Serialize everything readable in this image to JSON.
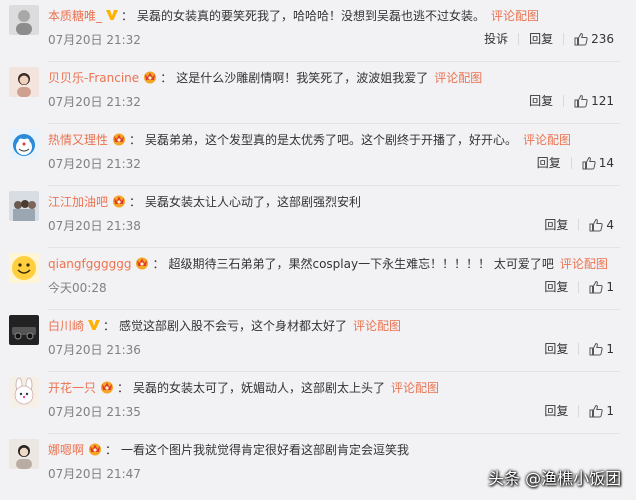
{
  "comments": [
    {
      "user": "本质糖唯_",
      "badge": "v",
      "text": "吴磊的女装真的要笑死我了，哈哈哈！没想到吴磊也逃不过女装。",
      "media_link": "评论配图",
      "time": "07月20日 21:32",
      "report": "投诉",
      "reply": "回复",
      "likes": "236"
    },
    {
      "user": "贝贝乐-Francine",
      "badge": "crown",
      "text": "这是什么沙雕剧情啊！我笑死了，波波姐我爱了",
      "media_link": "评论配图",
      "time": "07月20日 21:32",
      "report": "",
      "reply": "回复",
      "likes": "121"
    },
    {
      "user": "热情又理性",
      "badge": "crown",
      "text": "吴磊弟弟，这个发型真的是太优秀了吧。这个剧终于开播了，好开心。",
      "media_link": "评论配图",
      "time": "07月20日 21:32",
      "report": "",
      "reply": "回复",
      "likes": "14"
    },
    {
      "user": "江江加油吧",
      "badge": "crown",
      "text": "吴磊女装太让人心动了，这部剧强烈安利",
      "media_link": "",
      "time": "07月20日 21:38",
      "report": "",
      "reply": "回复",
      "likes": "4"
    },
    {
      "user": "qiangfgggggg",
      "badge": "crown",
      "text": "超级期待三石弟弟了，果然cosplay一下永生难忘！！！！！ 太可爱了吧",
      "media_link": "评论配图",
      "time": "今天00:28",
      "report": "",
      "reply": "回复",
      "likes": "1"
    },
    {
      "user": "白川崎",
      "badge": "v",
      "text": "感觉这部剧入股不会亏，这个身材都太好了",
      "media_link": "评论配图",
      "time": "07月20日 21:36",
      "report": "",
      "reply": "回复",
      "likes": "1"
    },
    {
      "user": "开花一只",
      "badge": "crown",
      "text": "吴磊的女装太可了，妩媚动人，这部剧太上头了",
      "media_link": "评论配图",
      "time": "07月20日 21:35",
      "report": "",
      "reply": "回复",
      "likes": "1"
    },
    {
      "user": "娜嗯啊",
      "badge": "crown",
      "text": "一看这个图片我就觉得肯定很好看这部剧肯定会逗笑我",
      "media_link": "",
      "time": "07月20日 21:47",
      "report": "",
      "reply": "",
      "likes": ""
    }
  ],
  "watermark": "头条 @渔樵小饭团",
  "colors": {
    "accent": "#eb7350",
    "text": "#333333",
    "meta": "#808080",
    "background": "#f2f2f5",
    "badge_v": "#ffb000",
    "badge_crown": "#f5a623"
  }
}
